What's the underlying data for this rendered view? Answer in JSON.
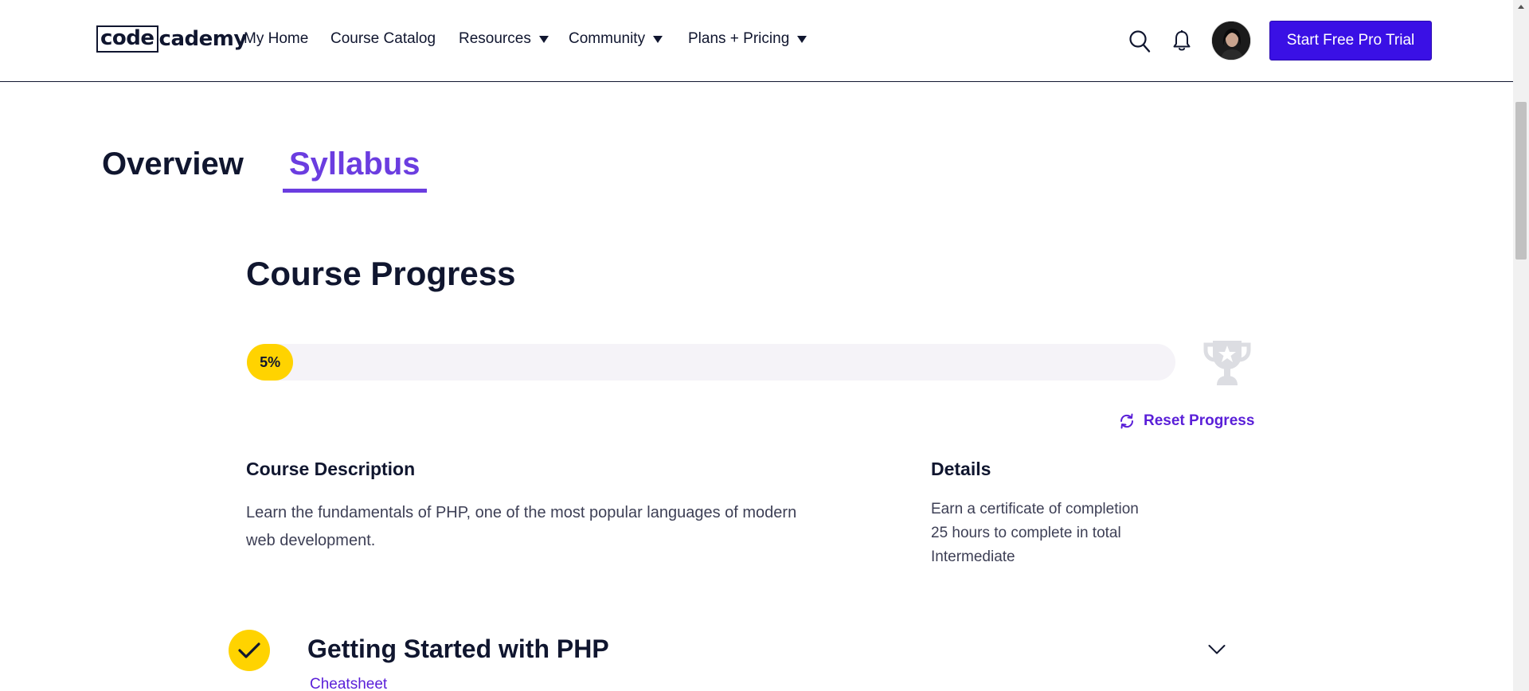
{
  "header": {
    "logo_code": "code",
    "logo_cademy": "cademy",
    "nav": [
      {
        "label": "My Home"
      },
      {
        "label": "Course Catalog"
      },
      {
        "label": "Resources"
      },
      {
        "label": "Community"
      },
      {
        "label": "Plans + Pricing"
      }
    ],
    "cta_label": "Start Free Pro Trial",
    "icons": {
      "search": "search-icon",
      "notifications": "bell-icon",
      "avatar": "user-avatar"
    }
  },
  "tabs": [
    {
      "label": "Overview",
      "active": false
    },
    {
      "label": "Syllabus",
      "active": true
    }
  ],
  "progress": {
    "title": "Course Progress",
    "percent": 5,
    "percent_label": "5%",
    "reset_label": "Reset Progress"
  },
  "description": {
    "heading": "Course Description",
    "text": "Learn the fundamentals of PHP, one of the most popular languages of modern web development."
  },
  "details": {
    "heading": "Details",
    "items": [
      "Earn a certificate of completion",
      "25 hours to complete in total",
      "Intermediate"
    ]
  },
  "modules": [
    {
      "title": "Getting Started with PHP",
      "completed": true,
      "link_label": "Cheatsheet"
    }
  ],
  "colors": {
    "accent_purple": "#6b3de0",
    "cta_blue": "#3a10e5",
    "progress_yellow": "#ffd300",
    "text_dark": "#10162f"
  }
}
